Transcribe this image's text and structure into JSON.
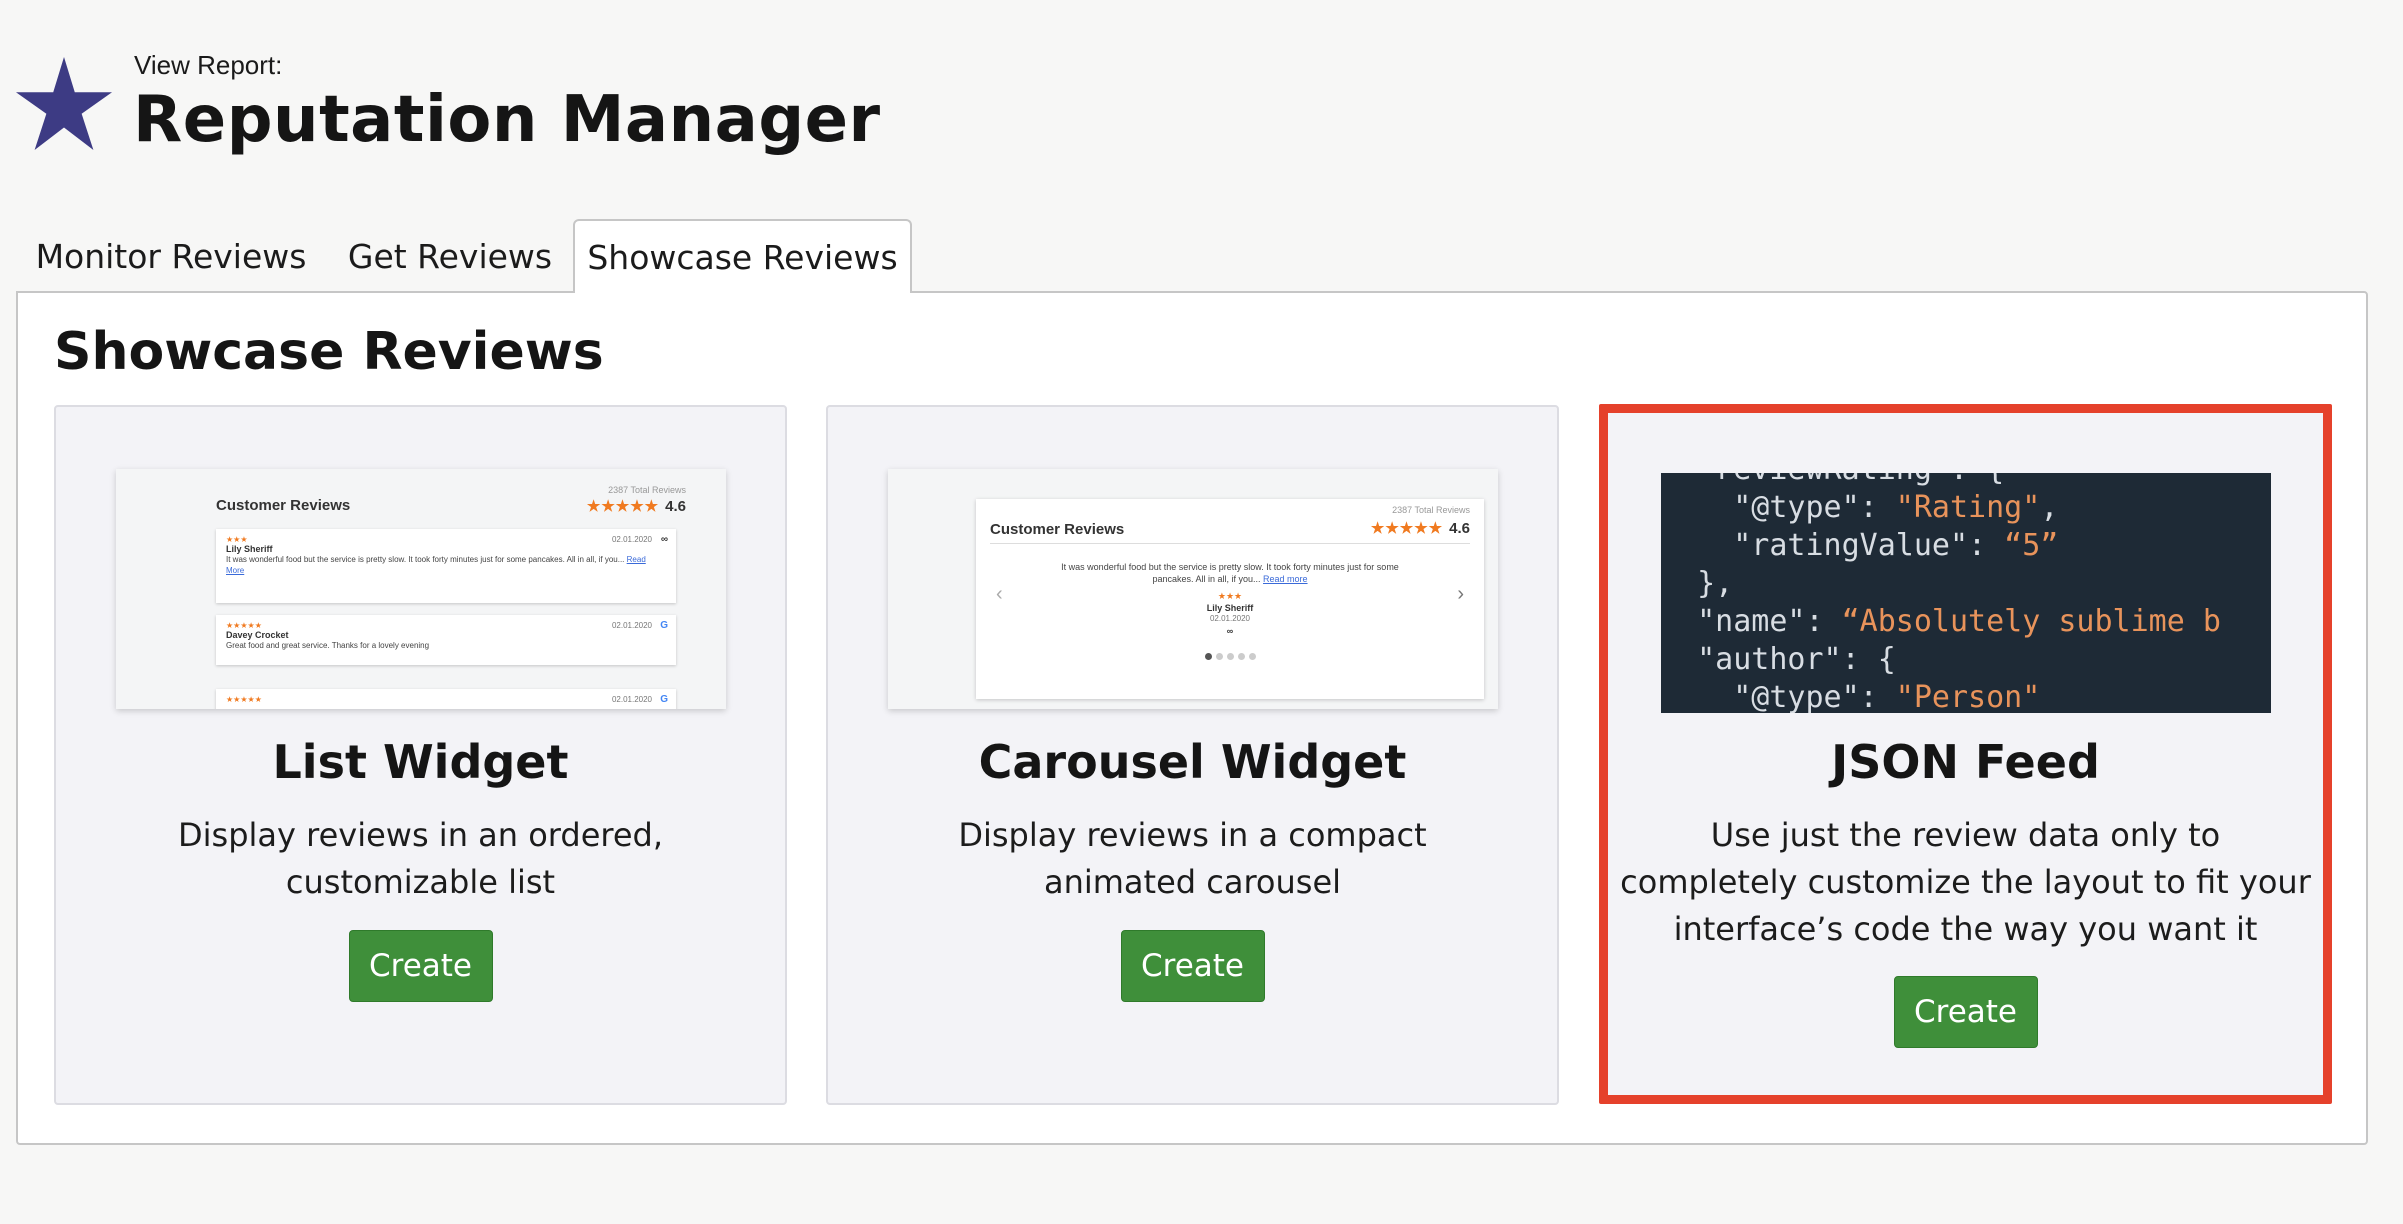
{
  "header": {
    "pre_title": "View Report:",
    "title": "Reputation Manager",
    "logo_icon": "star-icon",
    "logo_color": "#3d3b84"
  },
  "tabs": [
    {
      "label": "Monitor Reviews",
      "active": false
    },
    {
      "label": "Get Reviews",
      "active": false
    },
    {
      "label": "Showcase Reviews",
      "active": true
    }
  ],
  "panel": {
    "title": "Showcase Reviews"
  },
  "cards": [
    {
      "title": "List Widget",
      "description": "Display reviews in an ordered, customizable list",
      "button_label": "Create",
      "preview": {
        "title": "Customer Reviews",
        "total": "2387 Total Reviews",
        "rating": "4.6",
        "reviews": [
          {
            "stars": "★★★",
            "date": "02.01.2020",
            "source": "∞",
            "name": "Lily Sheriff",
            "text": "It was wonderful food but the service is pretty slow. It took forty minutes just for some pancakes. All in all, if you...",
            "link": "Read More"
          },
          {
            "stars": "★★★★★",
            "date": "02.01.2020",
            "source": "G",
            "name": "Davey Crocket",
            "text": "Great food and great service. Thanks for a lovely evening",
            "link": ""
          },
          {
            "stars": "★★★★★",
            "date": "02.01.2020",
            "source": "G",
            "name": "",
            "text": "",
            "link": ""
          }
        ]
      }
    },
    {
      "title": "Carousel Widget",
      "description": "Display reviews in a compact animated carousel",
      "button_label": "Create",
      "preview": {
        "title": "Customer Reviews",
        "total": "2387 Total Reviews",
        "rating": "4.6",
        "text": "It was wonderful food but the service is pretty slow. It took forty minutes just for some pancakes. All in all, if you...",
        "link": "Read more",
        "stars": "★★★",
        "name": "Lily Sheriff",
        "date": "02.01.2020",
        "source": "∞"
      }
    },
    {
      "title": "JSON Feed",
      "description": "Use just the review data only to completely customize the layout to fit your interface’s code the way you want it",
      "button_label": "Create",
      "highlighted": true,
      "highlight_color": "#e5412b",
      "preview": {
        "code_lines": [
          "  \"reviewRating\": {",
          "    \"@type\": \"Rating\",",
          "    \"ratingValue\": “5”",
          "  },",
          "  \"name\": “Absolutely sublime b",
          "  \"author\": {",
          "    \"@type\": \"Person\""
        ]
      }
    }
  ],
  "colors": {
    "create_button": "#3f8f3a",
    "star_rating": "#f07a20",
    "code_background": "#1e2a36"
  }
}
